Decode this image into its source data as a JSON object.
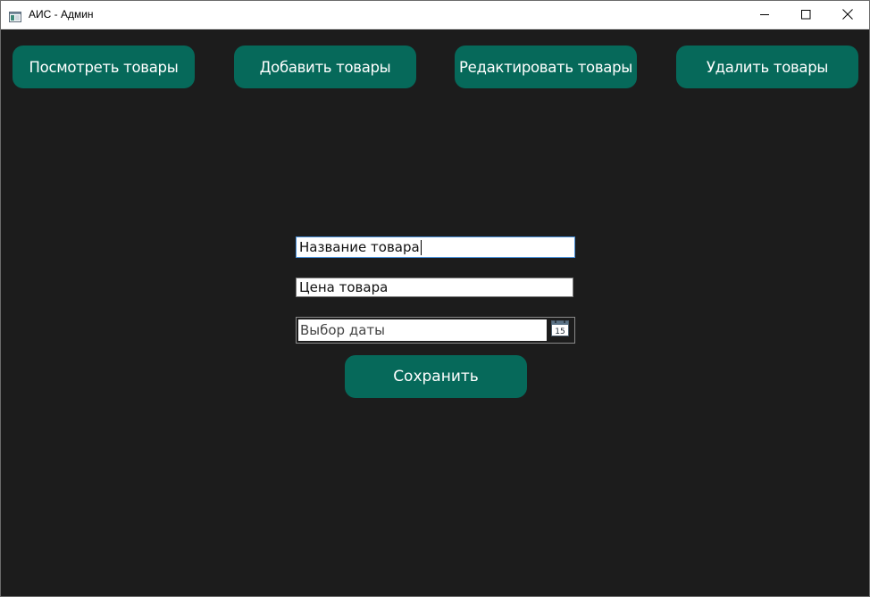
{
  "window": {
    "title": "АИС - Админ",
    "controls": {
      "minimize": "minimize-icon",
      "maximize": "maximize-icon",
      "close": "close-icon"
    }
  },
  "nav": {
    "view_label": "Посмотреть товары",
    "add_label": "Добавить товары",
    "edit_label": "Редактировать товары",
    "delete_label": "Удалить товары"
  },
  "form": {
    "name_value": "Название товара",
    "price_value": "Цена товара",
    "date_placeholder": "Выбор даты",
    "calendar_icon": "calendar-icon",
    "calendar_day": "15",
    "save_label": "Сохранить"
  },
  "colors": {
    "background": "#1c1c1c",
    "accent": "#06695a",
    "button_text": "#ffffff",
    "titlebar": "#ffffff",
    "focus_border": "#4a90d9"
  }
}
